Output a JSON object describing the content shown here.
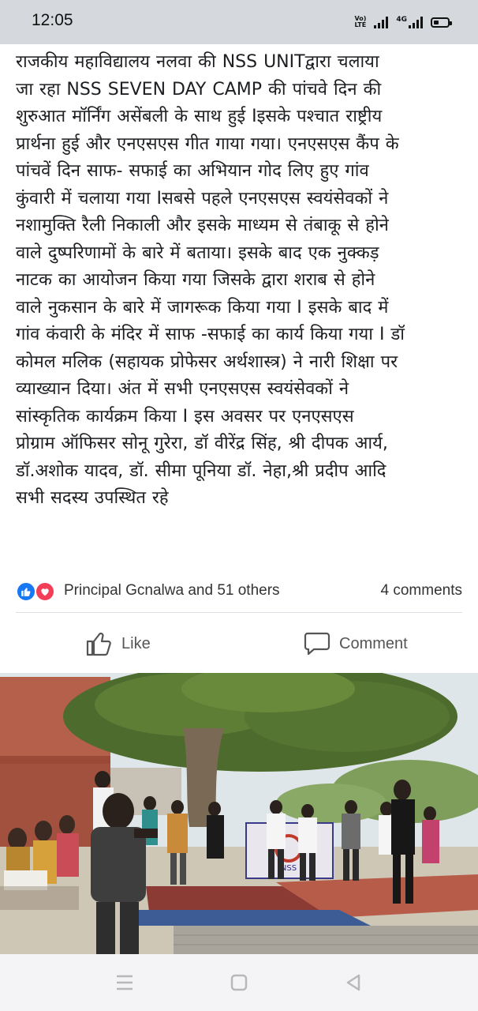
{
  "status_bar": {
    "time": "12:05",
    "volte_top": "Vo)",
    "volte_bottom": "LTE",
    "network": "4G",
    "icons": [
      "signal-icon",
      "4g-signal-icon",
      "battery-icon"
    ]
  },
  "post": {
    "body_lines": [
      "राजकीय महाविद्यालय नलवा की NSS UNITद्वारा चलाया",
      "जा रहा  NSS SEVEN DAY CAMP की पांचवे दिन की",
      "शुरुआत मॉर्निंग असेंबली के साथ हुई Iइसके पश्चात राष्ट्रीय",
      "प्रार्थना हुई और एनएसएस गीत गाया गया। एनएसएस कैंप के",
      "पांचवें  दिन साफ- सफाई का अभियान गोद लिए हुए गांव",
      "कुंवारी में चलाया गया Iसबसे पहले एनएसएस स्वयंसेवकों ने",
      "नशामुक्ति रैली निकाली और इसके माध्यम से तंबाकू से होने",
      "वाले दुष्परिणामों के बारे में बताया। इसके बाद एक नुक्कड़",
      "नाटक का आयोजन किया गया जिसके द्वारा शराब से होने",
      "वाले नुकसान के बारे में जागरूक किया गया I इसके बाद में",
      "गांव कंवारी के मंदिर में साफ -सफाई का कार्य किया गया I डॉ",
      "कोमल मलिक (सहायक प्रोफेसर अर्थशास्त्र) ने नारी शिक्षा पर",
      "व्याख्यान दिया। अंत  में सभी एनएसएस स्वयंसेवकों ने",
      "सांस्कृतिक कार्यक्रम किया I इस अवसर पर एनएसएस",
      "प्रोग्राम ऑफिसर सोनू गुरेरा,  डॉ वीरेंद्र सिंह, श्री दीपक आर्य,",
      "डॉ.अशोक यादव, डॉ. सीमा पूनिया डॉ. नेहा,श्री प्रदीप आदि",
      "सभी सदस्य उपस्थित रहे"
    ]
  },
  "reactions": {
    "icons": [
      "like-reaction-icon",
      "love-reaction-icon"
    ],
    "reactors": "Principal Gcnalwa and 51 others",
    "comments": "4 comments"
  },
  "actions": {
    "like_label": "Like",
    "comment_label": "Comment"
  },
  "photo": {
    "banner_text": "NSS"
  },
  "colors": {
    "status_bar_bg": "#d5d8dd",
    "like_blue": "#1877f2",
    "love_red": "#f33e58",
    "text": "#1c1e21"
  }
}
